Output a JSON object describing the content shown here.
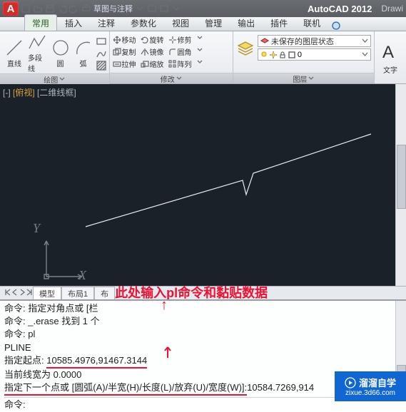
{
  "title": {
    "workspace": "草图与注释",
    "brand": "AutoCAD 2012",
    "file": "Drawi"
  },
  "ribbon": {
    "tabs": [
      "常用",
      "插入",
      "注释",
      "参数化",
      "视图",
      "管理",
      "输出",
      "插件",
      "联机"
    ],
    "draw": {
      "line": "直线",
      "pl": "多段线",
      "circle": "圆",
      "arc": "弧",
      "title": "绘图"
    },
    "modify": {
      "move": "移动",
      "rotate": "旋转",
      "trim": "修剪",
      "copy": "复制",
      "mirror": "镜像",
      "fillet": "圆角",
      "stretch": "拉伸",
      "scale": "缩放",
      "array": "阵列",
      "title": "修改"
    },
    "layer": {
      "unsaved": "未保存的图层状态",
      "title": "图层"
    },
    "text": {
      "label": "文字"
    }
  },
  "canvas": {
    "ctrls_pre": "[-] ",
    "ctrls_hl": "[俯视]",
    "ctrls_post": " [二维线框]",
    "y": "Y",
    "x": "X"
  },
  "layout": {
    "tabs": [
      "模型",
      "布局1",
      "布"
    ],
    "annotation": "此处输入pl命令和黏贴数据"
  },
  "cmd": {
    "l1": "命令: 指定对角点或 [栏",
    "l2": "命令: _.erase 找到 1 个",
    "l3": "命令: pl",
    "l4": "PLINE",
    "l5_a": "指定起点: ",
    "l5_b": "10585.4976,91467.3144",
    "l6": "当前线宽为 0.0000",
    "l7_a": "指定下一个",
    "l7_b": "点或 [圆弧(A)/半宽(H)/长度(L)/放弃(U)/宽度(W)]: ",
    "l7_c": "10584.7269,914",
    "l8": "命令:"
  },
  "watermark": {
    "name": "溜溜自学",
    "url": "zixue.3d66.com"
  }
}
